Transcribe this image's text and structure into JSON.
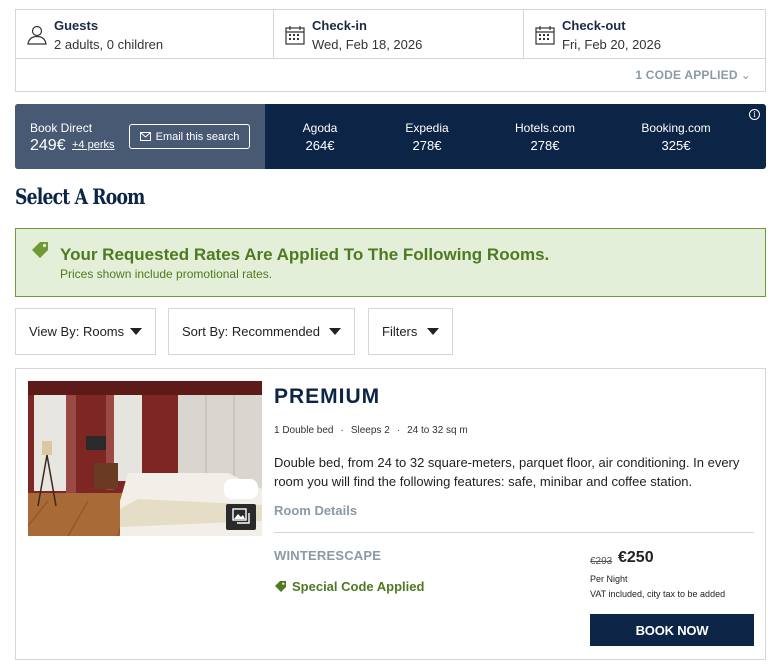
{
  "search": {
    "guests": {
      "label": "Guests",
      "value": "2 adults, 0 children",
      "icon": "person-icon"
    },
    "checkin": {
      "label": "Check-in",
      "value": "Wed, Feb 18, 2026",
      "icon": "calendar-icon"
    },
    "checkout": {
      "label": "Check-out",
      "value": "Fri, Feb 20, 2026",
      "icon": "calendar-icon"
    },
    "code_applied": "1 CODE APPLIED"
  },
  "price_compare": {
    "direct_label": "Book Direct",
    "direct_price": "249€",
    "perks": "+4 perks",
    "email_button": "Email this search",
    "competitors": [
      {
        "name": "Agoda",
        "price": "264€"
      },
      {
        "name": "Expedia",
        "price": "278€"
      },
      {
        "name": "Hotels.com",
        "price": "278€"
      },
      {
        "name": "Booking.com",
        "price": "325€"
      }
    ],
    "background": "#0c2446",
    "direct_background": "#485a73"
  },
  "page_title": "Select A Room",
  "notice": {
    "heading": "Your Requested Rates Are Applied To The Following Rooms.",
    "subtext": "Prices shown include promotional rates.",
    "color": "#4e7a21",
    "background": "#e3efd8"
  },
  "filters": {
    "view_by": "View By: Rooms",
    "sort_by": "Sort By: Recommended",
    "filters": "Filters"
  },
  "room": {
    "name": "PREMIUM",
    "specs": [
      "1 Double bed",
      "Sleeps 2",
      "24 to 32 sq m"
    ],
    "description": "Double bed, from 24 to 32 square-meters, parquet floor, air conditioning. In every room you will find the following features: safe, minibar and coffee station.",
    "details_link": "Room Details",
    "rate_code": "WINTERESCAPE",
    "special_label": "Special Code Applied",
    "old_price": "€293",
    "new_price": "€250",
    "per_night": "Per Night",
    "vat_note": "VAT included, city tax to be added",
    "book_button": "BOOK NOW"
  }
}
